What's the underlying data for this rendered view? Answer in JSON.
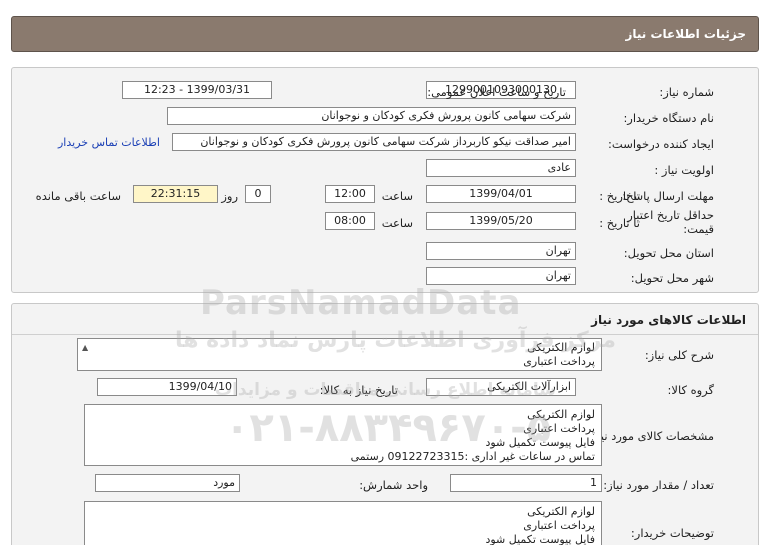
{
  "header": {
    "title": "جزئیات اطلاعات نیاز"
  },
  "details": {
    "need_number_label": "شماره نیاز:",
    "need_number": "1299001093000130",
    "announce_label": "تاریخ و ساعت اعلان عمومی:",
    "announce_value": "1399/03/31 - 12:23",
    "buyer_org_label": "نام دستگاه خریدار:",
    "buyer_org": "شرکت سهامی کانون پرورش فکری کودکان و نوجوانان",
    "requester_label": "ایجاد کننده درخواست:",
    "requester": "امیر صداقت نیکو کاربرداز شرکت سهامی کانون پرورش فکری کودکان و نوجوانان",
    "contact_link": "اطلاعات تماس خریدار",
    "priority_label": "اولویت نیاز :",
    "priority": "عادی",
    "deadline_label": "مهلت ارسال پاسخ:",
    "to_date_label": "تا تاریخ :",
    "deadline_date": "1399/04/01",
    "time_label": "ساعت",
    "deadline_time": "12:00",
    "days_value": "0",
    "days_label": "روز و",
    "remaining_time": "22:31:15",
    "remaining_label": "ساعت باقی مانده",
    "price_validity_label": "حداقل تاریخ اعتبار قیمت:",
    "price_to_date_label": "تا تاریخ :",
    "price_date": "1399/05/20",
    "price_time_label": "ساعت",
    "price_time": "08:00",
    "province_label": "استان محل تحویل:",
    "province": "تهران",
    "city_label": "شهر محل تحویل:",
    "city": "تهران"
  },
  "goods": {
    "section_title": "اطلاعات کالاهای مورد نیاز",
    "summary_label": "شرح کلی نیاز:",
    "summary_lines": [
      "لوازم الکتریکی",
      "پرداخت اعتباری"
    ],
    "group_label": "گروه کالا:",
    "group_value": "ابزارآلات الکتریکی",
    "need_date_label": "تاریخ نیاز به کالا:",
    "need_date": "1399/04/10",
    "spec_label": "مشخصات کالای مورد نیاز:",
    "spec_lines": [
      "لوازم الکتریکی",
      "پرداخت اعتباری",
      "فایل پیوست تکمیل شود",
      "تماس در ساعات غیر اداری :09122723315 رستمی"
    ],
    "qty_label": "تعداد / مقدار مورد نیاز:",
    "qty_value": "1",
    "unit_label": "واحد شمارش:",
    "unit_value": "مورد",
    "buyer_notes_label": "توضیحات خریدار:",
    "buyer_notes_lines": [
      "لوازم الکتریکی",
      "پرداخت اعتباری",
      "فایل پیوست تکمیل شود"
    ]
  },
  "watermark": {
    "brand": "ParsNamadData",
    "line1": "مرکز فرآوری اطلاعات پارس نماد داده ها",
    "line2": "سامانه اطلاع رسانی مناقصات و مزایدات",
    "phone": "۰۲۱-۸۸۳۴۹۶۷۰-۵"
  }
}
